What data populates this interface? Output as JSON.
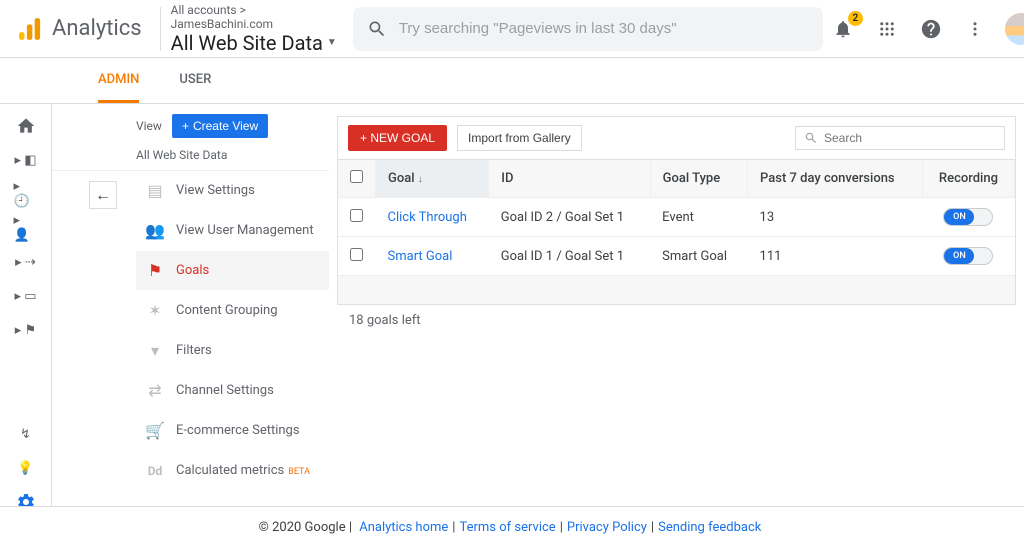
{
  "header": {
    "product": "Analytics",
    "breadcrumb": "All accounts > JamesBachini.com",
    "view_name": "All Web Site Data",
    "search_placeholder": "Try searching \"Pageviews in last 30 days\"",
    "notif_count": "2"
  },
  "tabs": {
    "admin": "ADMIN",
    "user": "USER"
  },
  "sidebar": {
    "head_label": "View",
    "create_label": "Create View",
    "subtitle": "All Web Site Data",
    "items": [
      {
        "label": "View Settings"
      },
      {
        "label": "View User Management"
      },
      {
        "label": "Goals"
      },
      {
        "label": "Content Grouping"
      },
      {
        "label": "Filters"
      },
      {
        "label": "Channel Settings"
      },
      {
        "label": "E-commerce Settings"
      },
      {
        "label": "Calculated metrics",
        "tag": "BETA"
      }
    ]
  },
  "goals": {
    "new_label": "+ NEW GOAL",
    "import_label": "Import from Gallery",
    "search_placeholder": "Search",
    "columns": {
      "goal": "Goal",
      "id": "ID",
      "type": "Goal Type",
      "conv": "Past 7 day conversions",
      "rec": "Recording"
    },
    "rows": [
      {
        "goal": "Click Through",
        "id": "Goal ID 2 / Goal Set 1",
        "type": "Event",
        "conv": "13",
        "rec": "ON"
      },
      {
        "goal": "Smart Goal",
        "id": "Goal ID 1 / Goal Set 1",
        "type": "Smart Goal",
        "conv": "111",
        "rec": "ON"
      }
    ],
    "remaining": "18 goals left"
  },
  "footer": {
    "copyright": "© 2020 Google",
    "links": [
      "Analytics home",
      "Terms of service",
      "Privacy Policy",
      "Sending feedback"
    ]
  }
}
